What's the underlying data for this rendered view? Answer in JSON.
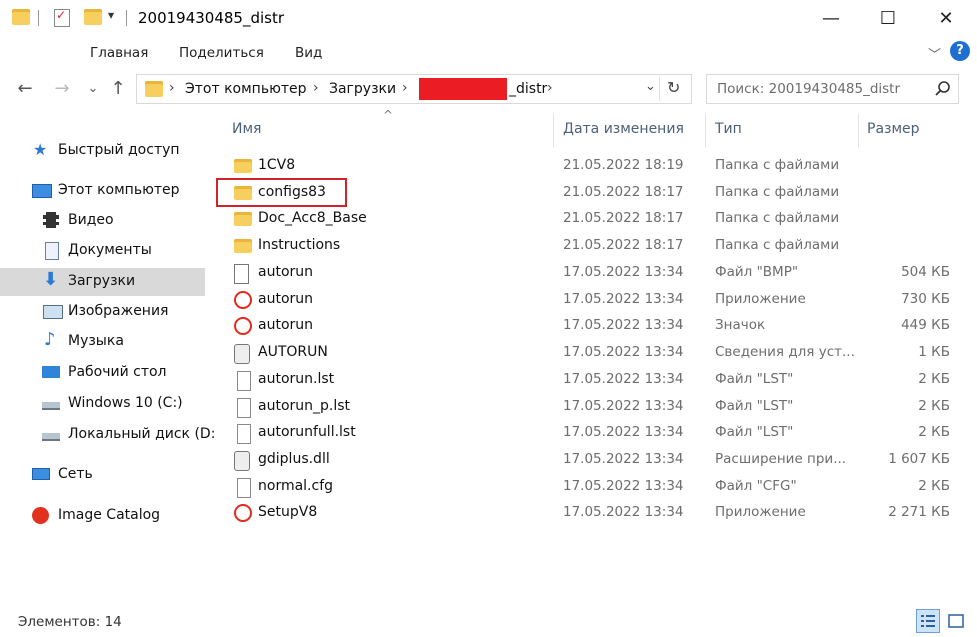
{
  "window": {
    "title": "20019430485_distr",
    "minimize_glyph": "—",
    "maximize_glyph": "☐",
    "close_glyph": "✕"
  },
  "ribbon": {
    "tabs": [
      "Главная",
      "Поделиться",
      "Вид"
    ],
    "expand_glyph": "﹀",
    "help_glyph": "?"
  },
  "nav": {
    "back_glyph": "←",
    "forward_glyph": "→",
    "recent_glyph": "⌄",
    "up_glyph": "↑"
  },
  "address": {
    "crumbs": [
      "Этот компьютер",
      "Загрузки",
      "_distr"
    ],
    "sep": "›",
    "dropdown_glyph": "⌄",
    "refresh_glyph": "↻"
  },
  "search": {
    "placeholder": "Поиск: 20019430485_distr"
  },
  "sidebar": {
    "items": [
      {
        "label": "Быстрый доступ",
        "icon": "star-icon"
      },
      {
        "label": "Этот компьютер",
        "icon": "computer-icon"
      },
      {
        "label": "Видео",
        "icon": "video-icon"
      },
      {
        "label": "Документы",
        "icon": "documents-icon"
      },
      {
        "label": "Загрузки",
        "icon": "downloads-icon",
        "selected": true
      },
      {
        "label": "Изображения",
        "icon": "pictures-icon"
      },
      {
        "label": "Музыка",
        "icon": "music-icon"
      },
      {
        "label": "Рабочий стол",
        "icon": "desktop-icon"
      },
      {
        "label": "Windows 10 (C:)",
        "icon": "drive-icon"
      },
      {
        "label": "Локальный диск (D:",
        "icon": "drive-icon"
      },
      {
        "label": "Сеть",
        "icon": "network-icon"
      },
      {
        "label": "Image Catalog",
        "icon": "image-catalog-icon"
      }
    ]
  },
  "columns": {
    "name": "Имя",
    "date": "Дата изменения",
    "type": "Тип",
    "size": "Размер",
    "sort_glyph": "^"
  },
  "files": [
    {
      "name": "1CV8",
      "date": "21.05.2022 18:19",
      "type": "Папка с файлами",
      "size": "",
      "icon": "folder-icon"
    },
    {
      "name": "configs83",
      "date": "21.05.2022 18:17",
      "type": "Папка с файлами",
      "size": "",
      "icon": "folder-icon"
    },
    {
      "name": "Doc_Acc8_Base",
      "date": "21.05.2022 18:17",
      "type": "Папка с файлами",
      "size": "",
      "icon": "folder-icon"
    },
    {
      "name": "Instructions",
      "date": "21.05.2022 18:17",
      "type": "Папка с файлами",
      "size": "",
      "icon": "folder-icon"
    },
    {
      "name": "autorun",
      "date": "17.05.2022 13:34",
      "type": "Файл \"BMP\"",
      "size": "504 КБ",
      "icon": "bmp-file-icon"
    },
    {
      "name": "autorun",
      "date": "17.05.2022 13:34",
      "type": "Приложение",
      "size": "730 КБ",
      "icon": "1c-app-icon"
    },
    {
      "name": "autorun",
      "date": "17.05.2022 13:34",
      "type": "Значок",
      "size": "449 КБ",
      "icon": "1c-app-icon"
    },
    {
      "name": "AUTORUN",
      "date": "17.05.2022 13:34",
      "type": "Сведения для уст...",
      "size": "1 КБ",
      "icon": "settings-file-icon"
    },
    {
      "name": "autorun.lst",
      "date": "17.05.2022 13:34",
      "type": "Файл \"LST\"",
      "size": "2 КБ",
      "icon": "file-icon"
    },
    {
      "name": "autorun_p.lst",
      "date": "17.05.2022 13:34",
      "type": "Файл \"LST\"",
      "size": "2 КБ",
      "icon": "file-icon"
    },
    {
      "name": "autorunfull.lst",
      "date": "17.05.2022 13:34",
      "type": "Файл \"LST\"",
      "size": "2 КБ",
      "icon": "file-icon"
    },
    {
      "name": "gdiplus.dll",
      "date": "17.05.2022 13:34",
      "type": "Расширение при...",
      "size": "1 607 КБ",
      "icon": "dll-file-icon"
    },
    {
      "name": "normal.cfg",
      "date": "17.05.2022 13:34",
      "type": "Файл \"CFG\"",
      "size": "2 КБ",
      "icon": "file-icon"
    },
    {
      "name": "SetupV8",
      "date": "17.05.2022 13:34",
      "type": "Приложение",
      "size": "2 271 КБ",
      "icon": "1c-app-icon"
    }
  ],
  "status": {
    "count_text": "Элементов: 14"
  },
  "colors": {
    "highlight": "#d1232a",
    "redaction": "#ec1c24",
    "folder": "#f7cf5e"
  }
}
